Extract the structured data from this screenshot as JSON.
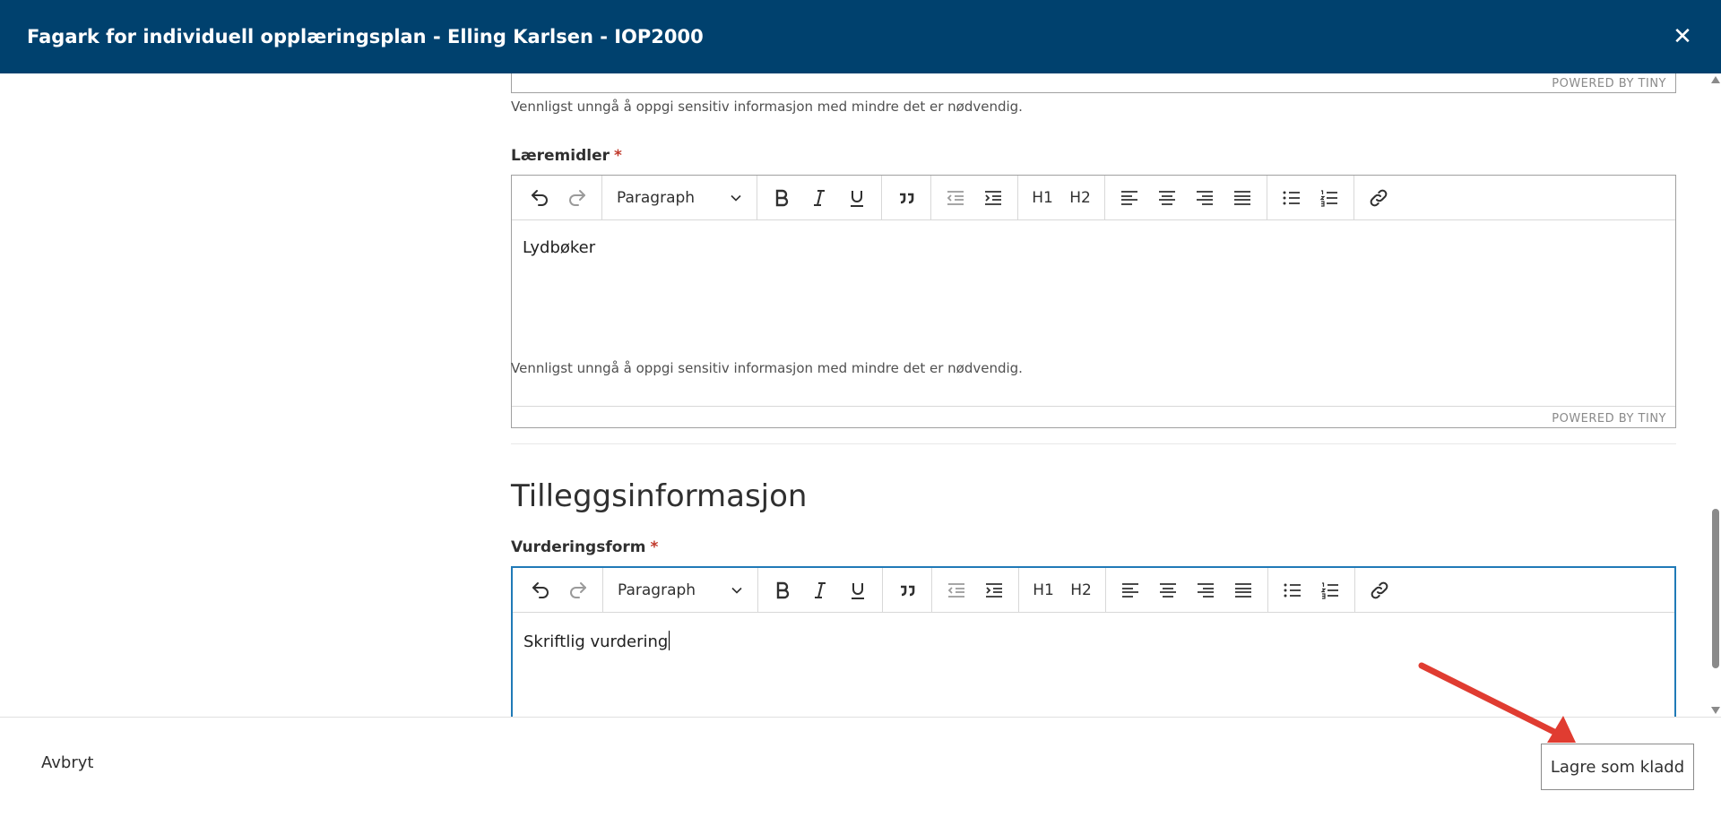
{
  "header": {
    "title": "Fagark for individuell opplæringsplan - Elling Karlsen - IOP2000",
    "close_glyph": "✕"
  },
  "editor_common": {
    "powered_by": "POWERED BY TINY",
    "hint": "Vennligst unngå å oppgi sensitiv informasjon med mindre det er nødvendig.",
    "block_format": "Paragraph",
    "h1": "H1",
    "h2": "H2"
  },
  "fields": {
    "laeremidler": {
      "label": "Læremidler",
      "required_mark": "*",
      "content": "Lydbøker"
    },
    "vurderingsform": {
      "label": "Vurderingsform",
      "required_mark": "*",
      "content": "Skriftlig vurdering"
    }
  },
  "section": {
    "title": "Tilleggsinformasjon"
  },
  "footer": {
    "cancel_label": "Avbryt",
    "save_draft_label": "Lagre som kladd"
  },
  "colors": {
    "header_bg": "#00416e",
    "focus_border": "#207ab7",
    "required": "#c0392b",
    "annotation_arrow": "#e03c31"
  }
}
